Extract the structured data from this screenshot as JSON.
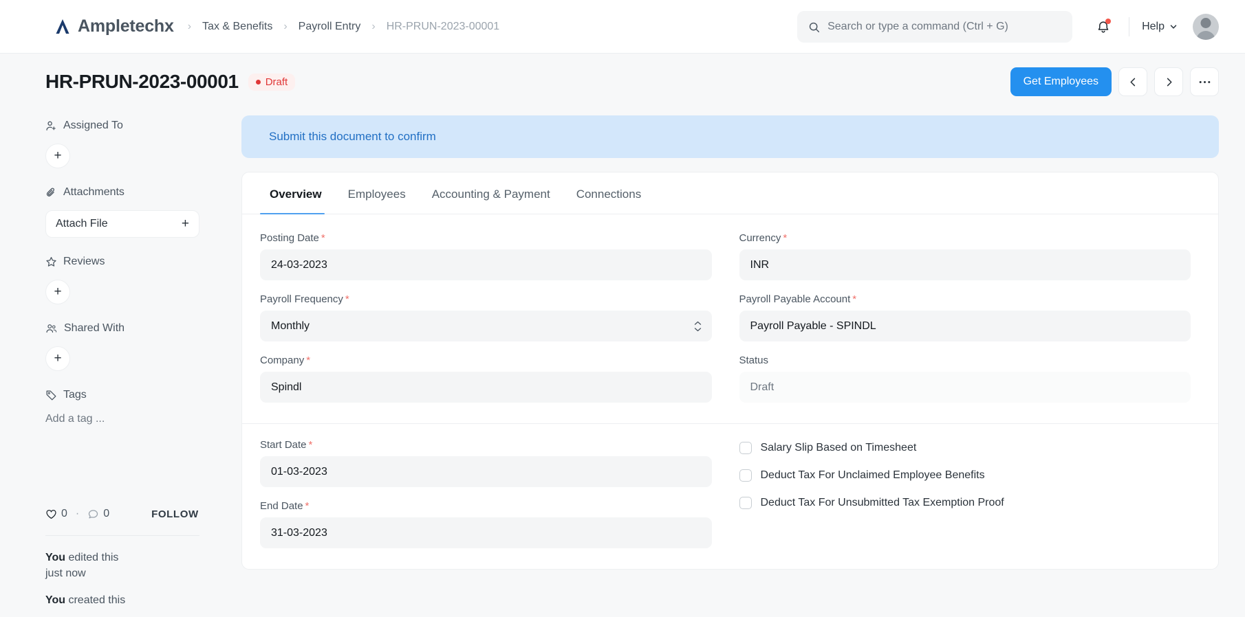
{
  "navbar": {
    "brand": "Ampletechx",
    "logo_icon": "ampletechx-logo",
    "breadcrumbs": [
      {
        "label": "Tax & Benefits",
        "muted": false
      },
      {
        "label": "Payroll Entry",
        "muted": false
      },
      {
        "label": "HR-PRUN-2023-00001",
        "muted": true
      }
    ],
    "search": {
      "placeholder": "Search or type a command (Ctrl + G)",
      "value": "",
      "icon": "search-icon"
    },
    "notifications": {
      "icon": "bell-icon",
      "has_unread": true,
      "dot_color": "#F2564A"
    },
    "help": {
      "label": "Help",
      "icon": "chevron-down-icon"
    },
    "avatar_icon": "user-avatar"
  },
  "page_head": {
    "title": "HR-PRUN-2023-00001",
    "status": {
      "label": "Draft",
      "color": "#E03636",
      "bg": "#FDF0EF"
    },
    "primary_action": "Get Employees",
    "prev_icon": "chevron-left-icon",
    "next_icon": "chevron-right-icon",
    "menu_icon": "ellipsis-icon"
  },
  "sidebar": {
    "assigned_to": {
      "label": "Assigned To",
      "icon": "user-plus-icon",
      "add": "+"
    },
    "attachments": {
      "label": "Attachments",
      "icon": "paperclip-icon",
      "button": "Attach File",
      "add": "+"
    },
    "reviews": {
      "label": "Reviews",
      "icon": "star-icon",
      "add": "+"
    },
    "shared_with": {
      "label": "Shared With",
      "icon": "users-icon",
      "add": "+"
    },
    "tags": {
      "label": "Tags",
      "icon": "tag-icon",
      "placeholder": "Add a tag ..."
    },
    "social": {
      "like_icon": "heart-icon",
      "like_count": "0",
      "separator": "·",
      "comment_icon": "comment-icon",
      "comment_count": "0",
      "follow_label": "FOLLOW"
    },
    "activity": [
      {
        "actor": "You",
        "text": " edited this",
        "time": "just now"
      },
      {
        "actor": "You",
        "text": " created this",
        "time": ""
      }
    ]
  },
  "banner": {
    "message": "Submit this document to confirm",
    "bg": "#D3E7FB",
    "color": "#2270C4"
  },
  "tabs": [
    {
      "label": "Overview",
      "active": true
    },
    {
      "label": "Employees",
      "active": false
    },
    {
      "label": "Accounting & Payment",
      "active": false
    },
    {
      "label": "Connections",
      "active": false
    }
  ],
  "form": {
    "section1": {
      "left": [
        {
          "label": "Posting Date",
          "required": true,
          "value": "24-03-2023",
          "type": "date",
          "readonly": false
        },
        {
          "label": "Payroll Frequency",
          "required": true,
          "value": "Monthly",
          "type": "select",
          "readonly": false
        },
        {
          "label": "Company",
          "required": true,
          "value": "Spindl",
          "type": "link",
          "readonly": false
        }
      ],
      "right": [
        {
          "label": "Currency",
          "required": true,
          "value": "INR",
          "type": "link",
          "readonly": false
        },
        {
          "label": "Payroll Payable Account",
          "required": true,
          "value": "Payroll Payable - SPINDL",
          "type": "link",
          "readonly": false
        },
        {
          "label": "Status",
          "required": false,
          "value": "Draft",
          "type": "select",
          "readonly": true
        }
      ]
    },
    "section2": {
      "left": [
        {
          "label": "Start Date",
          "required": true,
          "value": "01-03-2023",
          "type": "date",
          "readonly": false
        },
        {
          "label": "End Date",
          "required": true,
          "value": "31-03-2023",
          "type": "date",
          "readonly": false
        }
      ],
      "checkboxes": [
        {
          "label": "Salary Slip Based on Timesheet",
          "checked": false
        },
        {
          "label": "Deduct Tax For Unclaimed Employee Benefits",
          "checked": false
        },
        {
          "label": "Deduct Tax For Unsubmitted Tax Exemption Proof",
          "checked": false
        }
      ]
    }
  },
  "theme": {
    "accent": "#2490EF",
    "tab_underline": "#4FA0EF",
    "field_bg": "#F4F5F6",
    "page_bg": "#F7F8F9"
  }
}
